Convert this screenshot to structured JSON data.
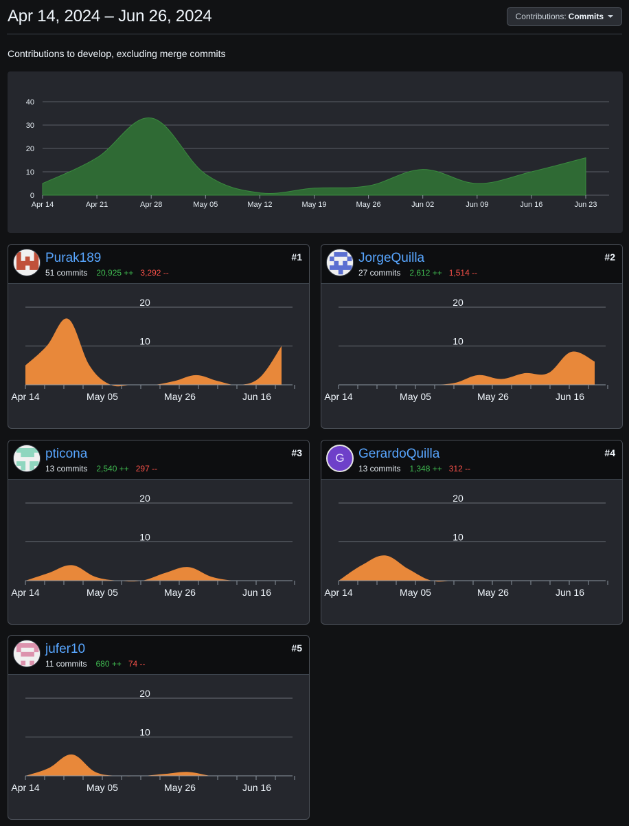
{
  "header": {
    "date_range": "Apr 14, 2024 – Jun 26, 2024",
    "contrib_button": {
      "prefix": "Contributions:",
      "value": "Commits"
    }
  },
  "subtitle": "Contributions to develop, excluding merge commits",
  "colors": {
    "main_fill": "#2f6a34",
    "main_stroke": "#3a8a3f",
    "mini_fill": "#e8883a",
    "add": "#3fb950",
    "del": "#f85149",
    "link": "#58a6ff"
  },
  "chart_data": [
    {
      "type": "area",
      "title": "",
      "x_ticks": [
        "Apr 14",
        "Apr 21",
        "Apr 28",
        "May 05",
        "May 12",
        "May 19",
        "May 26",
        "Jun 02",
        "Jun 09",
        "Jun 16",
        "Jun 23"
      ],
      "ylim": [
        0,
        40
      ],
      "y_ticks": [
        0,
        10,
        20,
        30,
        40
      ],
      "series": [
        {
          "values": [
            5,
            16,
            33,
            9,
            1,
            3,
            4,
            11,
            5,
            10,
            16
          ]
        }
      ],
      "grid": true
    }
  ],
  "contributors": [
    {
      "rank": "#1",
      "name": "Purak189",
      "commits": "51 commits",
      "additions": "20,925 ++",
      "deletions": "3,292 --",
      "avatar": {
        "type": "identicon",
        "color": "#c0503a",
        "pattern": "purak"
      },
      "chart_data": {
        "type": "area",
        "x_ticks": [
          "Apr 14",
          "May 05",
          "May 26",
          "Jun 16"
        ],
        "y_ticks": [
          10,
          20
        ],
        "ylim": [
          0,
          25
        ],
        "values": [
          5,
          10,
          17,
          5,
          0,
          0,
          0,
          1,
          2.5,
          1,
          0,
          2,
          10
        ]
      }
    },
    {
      "rank": "#2",
      "name": "JorgeQuilla",
      "commits": "27 commits",
      "additions": "2,612 ++",
      "deletions": "1,514 --",
      "avatar": {
        "type": "identicon",
        "color": "#5b6fd1",
        "pattern": "jorge"
      },
      "chart_data": {
        "type": "area",
        "x_ticks": [
          "Apr 14",
          "May 05",
          "May 26",
          "Jun 16"
        ],
        "y_ticks": [
          10,
          20
        ],
        "ylim": [
          0,
          25
        ],
        "values": [
          0,
          0,
          0,
          0,
          0,
          0.5,
          2.5,
          1.5,
          3,
          3,
          8.5,
          6
        ]
      }
    },
    {
      "rank": "#3",
      "name": "pticona",
      "commits": "13 commits",
      "additions": "2,540 ++",
      "deletions": "297 --",
      "avatar": {
        "type": "identicon",
        "color": "#8fd6bf",
        "pattern": "pticona"
      },
      "chart_data": {
        "type": "area",
        "x_ticks": [
          "Apr 14",
          "May 05",
          "May 26",
          "Jun 16"
        ],
        "y_ticks": [
          10,
          20
        ],
        "ylim": [
          0,
          25
        ],
        "values": [
          0,
          2,
          4,
          1,
          0,
          0,
          2,
          3.5,
          1,
          0,
          0,
          0
        ]
      }
    },
    {
      "rank": "#4",
      "name": "GerardoQuilla",
      "commits": "13 commits",
      "additions": "1,348 ++",
      "deletions": "312 --",
      "avatar": {
        "type": "letter",
        "letter": "G"
      },
      "chart_data": {
        "type": "area",
        "x_ticks": [
          "Apr 14",
          "May 05",
          "May 26",
          "Jun 16"
        ],
        "y_ticks": [
          10,
          20
        ],
        "ylim": [
          0,
          25
        ],
        "values": [
          0,
          4,
          6.5,
          3,
          0,
          0,
          0,
          0,
          0,
          0,
          0,
          0
        ]
      }
    },
    {
      "rank": "#5",
      "name": "jufer10",
      "commits": "11 commits",
      "additions": "680 ++",
      "deletions": "74 --",
      "avatar": {
        "type": "identicon",
        "color": "#dc92ad",
        "pattern": "jufer"
      },
      "chart_data": {
        "type": "area",
        "x_ticks": [
          "Apr 14",
          "May 05",
          "May 26",
          "Jun 16"
        ],
        "y_ticks": [
          10,
          20
        ],
        "ylim": [
          0,
          25
        ],
        "values": [
          0,
          2,
          5.5,
          1,
          0,
          0,
          0.5,
          1,
          0,
          0,
          0,
          0
        ]
      }
    }
  ]
}
